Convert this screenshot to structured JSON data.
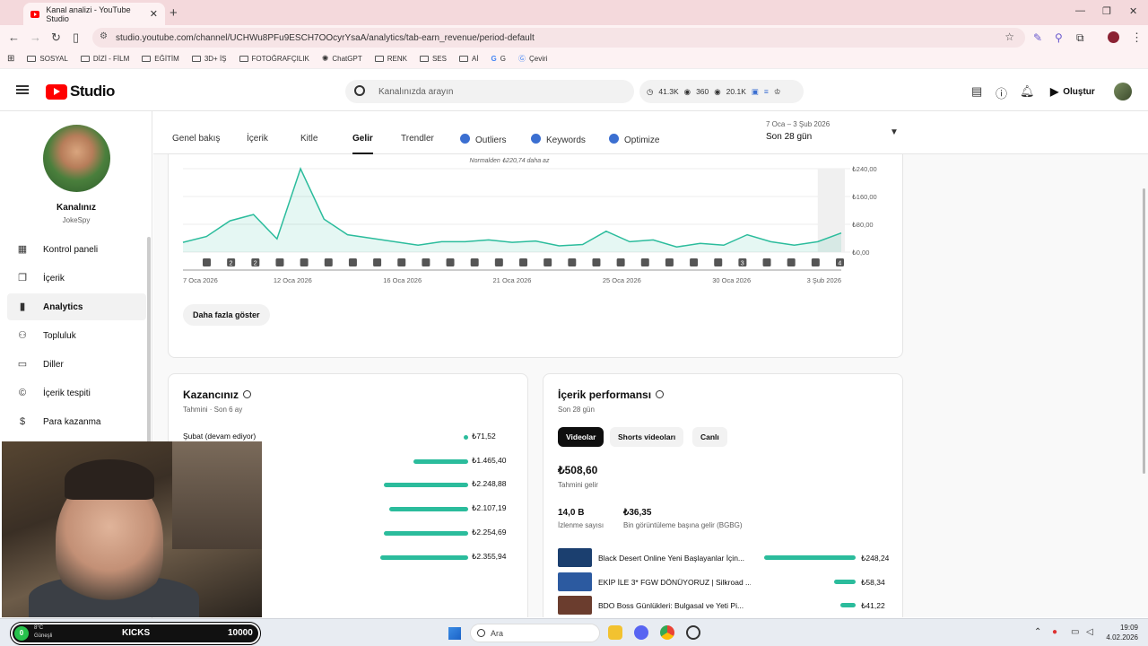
{
  "browser": {
    "tab_title": "Kanal analizi - YouTube Studio",
    "url": "studio.youtube.com/channel/UCHWu8PFu9ESCH7OOcyrYsaA/analytics/tab-earn_revenue/period-default",
    "bookmarks": [
      "SOSYAL",
      "DİZİ - FİLM",
      "EĞİTİM",
      "3D+ İŞ",
      "FOTOĞRAFÇILIK",
      "ChatGPT",
      "RENK",
      "SES",
      "Aİ",
      "G",
      "Çeviri"
    ]
  },
  "header": {
    "logo_text": "Studio",
    "search_placeholder": "Kanalınızda arayın",
    "stat_views": "41.3K",
    "stat_watch": "360",
    "stat_subs": "20.1K",
    "create_label": "Oluştur"
  },
  "sidebar": {
    "channel_name": "Kanalınız",
    "channel_handle": "JokeSpy",
    "items": [
      {
        "label": "Kontrol paneli",
        "icon": "dashboard-icon"
      },
      {
        "label": "İçerik",
        "icon": "content-icon"
      },
      {
        "label": "Analytics",
        "icon": "analytics-icon"
      },
      {
        "label": "Topluluk",
        "icon": "community-icon"
      },
      {
        "label": "Diller",
        "icon": "subtitles-icon"
      },
      {
        "label": "İçerik tespiti",
        "icon": "copyright-icon"
      },
      {
        "label": "Para kazanma",
        "icon": "monetization-icon"
      }
    ]
  },
  "tabs": {
    "items": [
      "Genel bakış",
      "İçerik",
      "Kitle",
      "Gelir",
      "Trendler",
      "Outliers",
      "Keywords",
      "Optimize"
    ],
    "active": "Gelir",
    "date_range": "7 Oca – 3 Şub 2026",
    "date_label": "Son 28 gün"
  },
  "chart": {
    "note": "Normalden ₺220,74 daha az",
    "more_button": "Daha fazla göster"
  },
  "chart_data": {
    "type": "area",
    "x_labels": [
      "7 Oca 2026",
      "12 Oca 2026",
      "16 Oca 2026",
      "21 Oca 2026",
      "25 Oca 2026",
      "30 Oca 2026",
      "3 Şub 2026"
    ],
    "y_tick_labels": [
      "₺240,00",
      "₺160,00",
      "₺80,00",
      "₺0,00"
    ],
    "ylim": [
      0,
      240
    ],
    "values": [
      28,
      45,
      90,
      108,
      38,
      240,
      95,
      50,
      40,
      30,
      20,
      30,
      30,
      35,
      28,
      32,
      18,
      22,
      60,
      30,
      35,
      15,
      25,
      20,
      50,
      30,
      20,
      30,
      55
    ],
    "marker_labels": [
      "",
      "2",
      "2",
      "",
      "",
      "",
      "",
      "",
      "",
      "",
      "",
      "",
      "",
      "",
      "",
      "",
      "",
      "",
      "",
      "",
      "",
      "",
      "3",
      "",
      "",
      "",
      "4"
    ],
    "color": "#2bbc9c"
  },
  "earnings": {
    "title": "Kazancınız",
    "subtitle": "Tahmini · Son 6 ay",
    "rows": [
      {
        "label": "Şubat (devam ediyor)",
        "value": "₺71,52",
        "amount": 71.52
      },
      {
        "label": "",
        "value": "₺1.465,40",
        "amount": 1465.4
      },
      {
        "label": "",
        "value": "₺2.248,88",
        "amount": 2248.88
      },
      {
        "label": "",
        "value": "₺2.107,19",
        "amount": 2107.19
      },
      {
        "label": "",
        "value": "₺2.254,69",
        "amount": 2254.69
      },
      {
        "label": "",
        "value": "₺2.355,94",
        "amount": 2355.94
      }
    ]
  },
  "performance": {
    "title": "İçerik performansı",
    "subtitle": "Son 28 gün",
    "chips": [
      "Videolar",
      "Shorts videoları",
      "Canlı"
    ],
    "total_value": "₺508,60",
    "total_label": "Tahmini gelir",
    "views_value": "14,0 B",
    "views_label": "İzlenme sayısı",
    "rpm_value": "₺36,35",
    "rpm_label": "Bin görüntüleme başına gelir (BGBG)",
    "videos": [
      {
        "title": "Black Desert Online Yeni Başlayanlar İçin...",
        "value": "₺248,24",
        "amount": 248.24
      },
      {
        "title": "EKİP İLE 3* FGW DÖNÜYORUZ | Silkroad ...",
        "value": "₺58,34",
        "amount": 58.34
      },
      {
        "title": "BDO Boss Günlükleri: Bulgasal ve Yeti Pi...",
        "value": "₺41,22",
        "amount": 41.22
      }
    ]
  },
  "overlay": {
    "weather_temp": "8°C",
    "weather_text": "Güneşli",
    "kicks_label": "KICKS",
    "kicks_value": "10000",
    "gc_value": "0"
  },
  "taskbar": {
    "search_placeholder": "Ara",
    "time": "19:09",
    "date": "4.02.2026"
  }
}
